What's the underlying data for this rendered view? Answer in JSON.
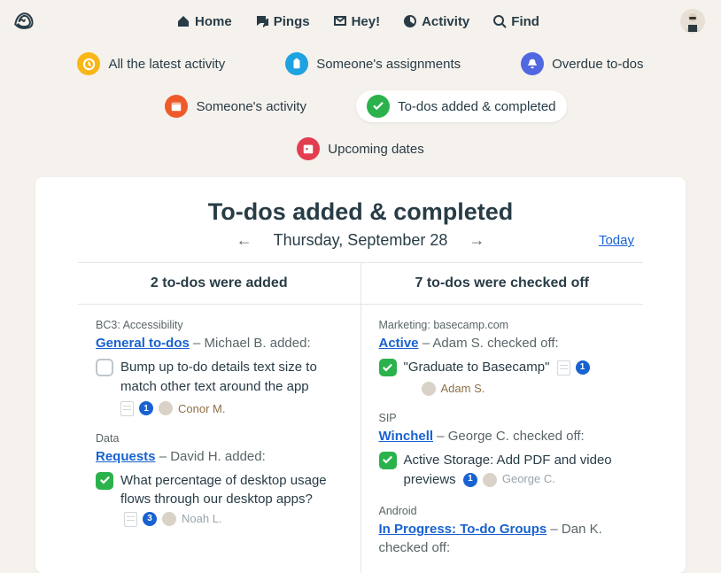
{
  "nav": {
    "home": "Home",
    "pings": "Pings",
    "hey": "Hey!",
    "activity": "Activity",
    "find": "Find"
  },
  "filters": {
    "latest": "All the latest activity",
    "assignments": "Someone's assignments",
    "overdue": "Overdue to-dos",
    "someone_activity": "Someone's activity",
    "todos_added_completed": "To-dos added & completed",
    "upcoming": "Upcoming dates"
  },
  "page": {
    "title": "To-dos added & completed",
    "date": "Thursday, September 28",
    "today": "Today"
  },
  "added": {
    "heading": "2 to-dos were added",
    "groups": [
      {
        "crumb": "BC3: Accessibility",
        "list_name": "General to-dos",
        "by": " – Michael B. added:",
        "todo": "Bump up to-do details text size to match other text around the app",
        "checked": false,
        "badge": "1",
        "person": "Conor M."
      },
      {
        "crumb": "Data",
        "list_name": "Requests",
        "by": " – David H. added:",
        "todo": "What percentage of desktop usage flows through our desktop apps?",
        "checked": true,
        "badge": "3",
        "person": "Noah L."
      }
    ]
  },
  "completed": {
    "heading": "7 to-dos were checked off",
    "groups": [
      {
        "crumb": "Marketing: basecamp.com",
        "list_name": "Active",
        "by": " – Adam S. checked off:",
        "todo": "\"Graduate to Basecamp\"",
        "checked": true,
        "badge": "1",
        "person": "Adam S.",
        "meta_below": true
      },
      {
        "crumb": "SIP",
        "list_name": "Winchell",
        "by": " – George C. checked off:",
        "todo": "Active Storage: Add PDF and video previews",
        "checked": true,
        "badge": "1",
        "person": "George C.",
        "meta_inline": true,
        "person_grey": true
      },
      {
        "crumb": "Android",
        "list_name": "In Progress: To-do Groups",
        "by": " – Dan K. checked off:",
        "todo": "",
        "checked": true
      }
    ]
  }
}
